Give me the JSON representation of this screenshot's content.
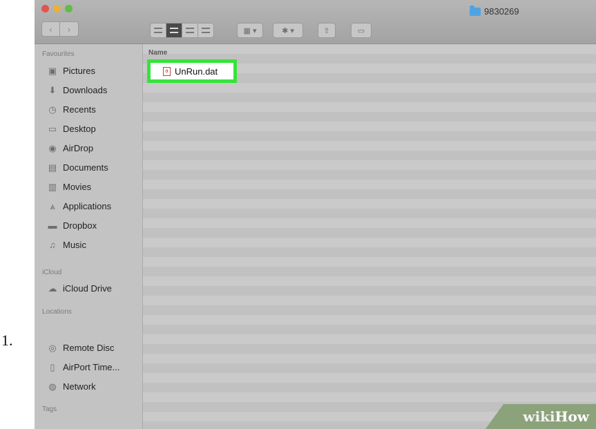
{
  "step": {
    "number": "1."
  },
  "window": {
    "title": "9830269",
    "nav": {
      "back_glyph": "‹",
      "forward_glyph": "›"
    }
  },
  "sidebar": {
    "sections": [
      {
        "heading": "Favourites",
        "items": [
          {
            "label": "Pictures",
            "icon": "camera-icon"
          },
          {
            "label": "Downloads",
            "icon": "download-icon"
          },
          {
            "label": "Recents",
            "icon": "clock-icon"
          },
          {
            "label": "Desktop",
            "icon": "desktop-icon"
          },
          {
            "label": "AirDrop",
            "icon": "airdrop-icon"
          },
          {
            "label": "Documents",
            "icon": "document-icon"
          },
          {
            "label": "Movies",
            "icon": "film-icon"
          },
          {
            "label": "Applications",
            "icon": "applications-icon"
          },
          {
            "label": "Dropbox",
            "icon": "folder-icon"
          },
          {
            "label": "Music",
            "icon": "music-icon"
          }
        ]
      },
      {
        "heading": "iCloud",
        "items": [
          {
            "label": "iCloud Drive",
            "icon": "cloud-icon"
          }
        ]
      },
      {
        "heading": "Locations",
        "items": [
          {
            "label": "Remote Disc",
            "icon": "disc-icon"
          },
          {
            "label": "AirPort Time...",
            "icon": "drive-icon"
          },
          {
            "label": "Network",
            "icon": "globe-icon"
          }
        ]
      },
      {
        "heading": "Tags",
        "items": []
      }
    ]
  },
  "list": {
    "column_header": "Name",
    "files": [
      {
        "name": "UnRun.dat",
        "highlighted": true
      }
    ]
  },
  "watermark": {
    "part1": "wiki",
    "part2": "How"
  },
  "colors": {
    "highlight": "#35e43a",
    "folder": "#4fa3e3"
  }
}
